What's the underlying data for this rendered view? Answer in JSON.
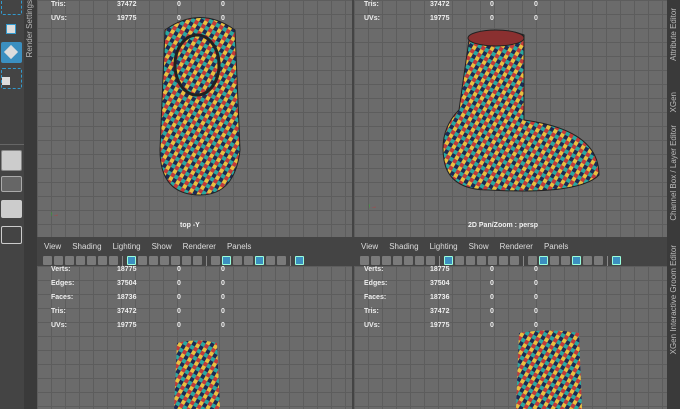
{
  "side_tabs": {
    "left": "Render Settings",
    "right": [
      "Attribute Editor",
      "XGen",
      "Channel Box / Layer Editor",
      "XGen Interactive Groom Editor"
    ]
  },
  "stat_labels": [
    "Verts:",
    "Edges:",
    "Faces:",
    "Tris:",
    "UVs:"
  ],
  "stat_values": [
    "18775",
    "37504",
    "18736",
    "37472",
    "19775"
  ],
  "stat_zero": "0",
  "top_left": {
    "camera_label": "top -Y",
    "rows": [
      {
        "label": "Tris:",
        "value": "37472"
      },
      {
        "label": "UVs:",
        "value": "19775"
      }
    ]
  },
  "top_right": {
    "camera_label": "2D Pan/Zoom : persp",
    "rows": [
      {
        "label": "Tris:",
        "value": "37472"
      },
      {
        "label": "UVs:",
        "value": "19775"
      }
    ]
  },
  "menu": [
    "View",
    "Shading",
    "Lighting",
    "Show",
    "Renderer",
    "Panels"
  ],
  "colors": {
    "accent": "#3b8fc0",
    "viewport_bg": "#6b6b6b",
    "panel": "#444444"
  }
}
